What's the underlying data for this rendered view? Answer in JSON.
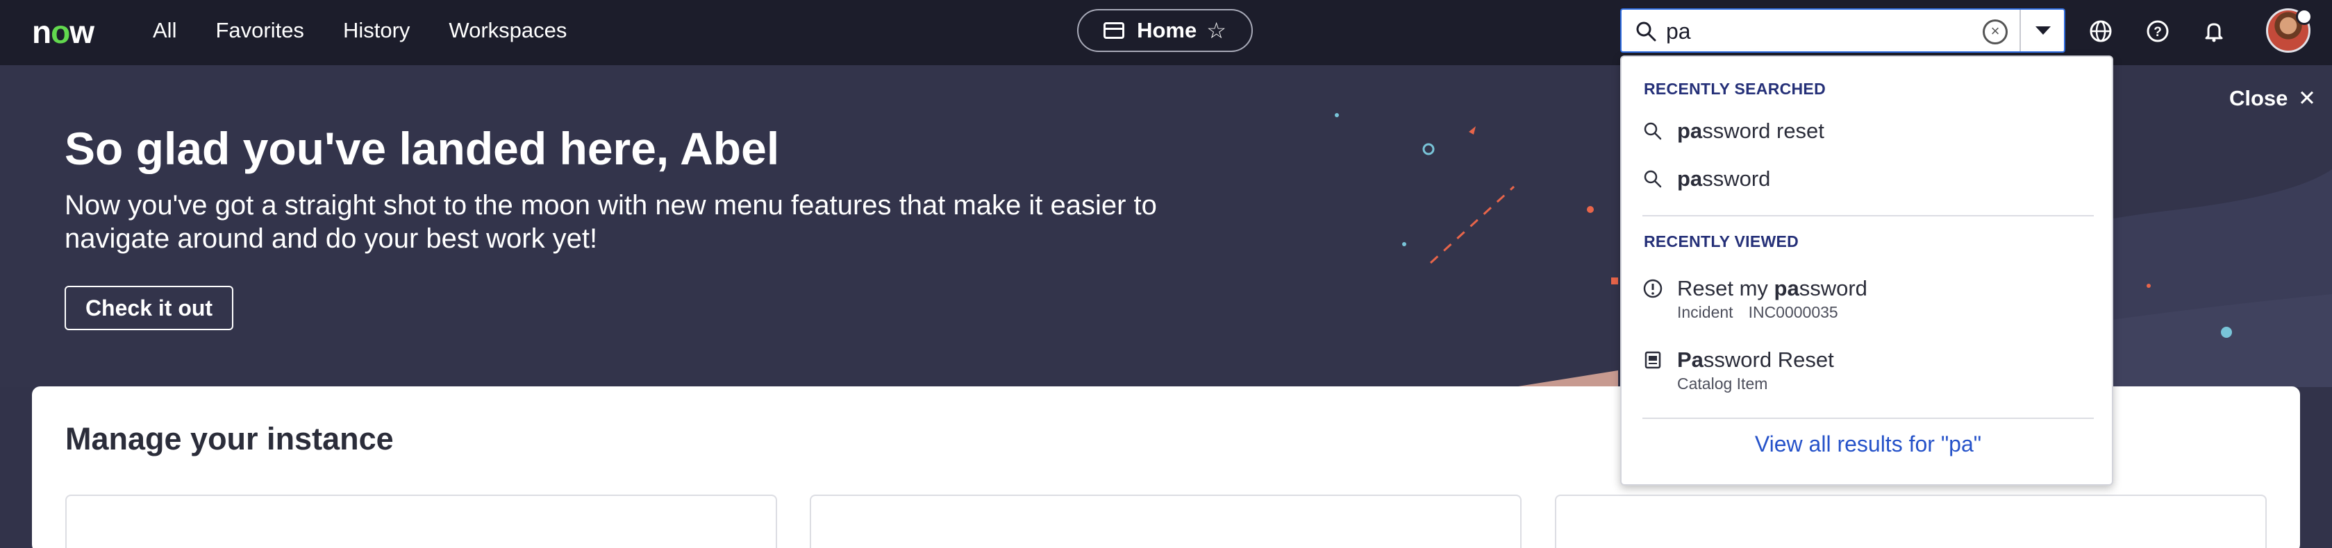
{
  "nav": {
    "logo": "now",
    "links": [
      "All",
      "Favorites",
      "History",
      "Workspaces"
    ],
    "home_label": "Home",
    "icons": [
      "globe-icon",
      "help-icon",
      "bell-icon"
    ]
  },
  "search": {
    "value": "pa",
    "recently_searched_heading": "RECENTLY SEARCHED",
    "recent_searches": [
      {
        "match": "pa",
        "rest": "ssword reset"
      },
      {
        "match": "pa",
        "rest": "ssword"
      }
    ],
    "recently_viewed_heading": "RECENTLY VIEWED",
    "recent_viewed": [
      {
        "pre": "Reset my ",
        "match": "pa",
        "rest": "ssword",
        "type": "Incident",
        "number": "INC0000035",
        "icon": "incident-icon"
      },
      {
        "pre": "",
        "match": "Pa",
        "rest": "ssword Reset",
        "type": "Catalog Item",
        "number": "",
        "icon": "catalog-item-icon"
      }
    ],
    "view_all": "View all results for \"pa\""
  },
  "banner": {
    "title": "So glad you've landed here, Abel",
    "subtitle": "Now you've got a straight shot to the moon with new menu features that make it easier to navigate around and do your best work yet!",
    "cta": "Check it out",
    "close": "Close"
  },
  "main": {
    "title": "Manage your instance"
  },
  "colors": {
    "nav_bg": "#1c1d2b",
    "banner_bg": "#33344b",
    "accent_blue": "#2f6de1",
    "section_heading": "#253078",
    "link_blue": "#2552c9",
    "logo_green": "#62d84e"
  }
}
